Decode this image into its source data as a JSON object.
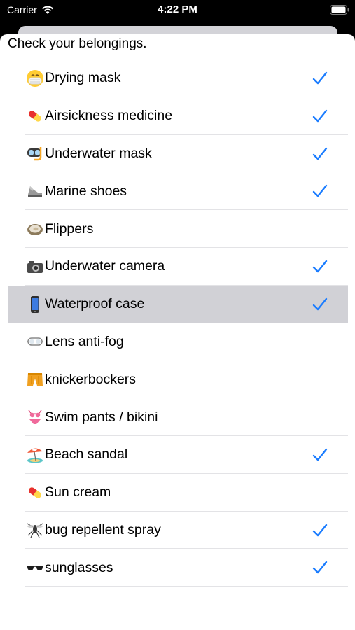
{
  "status_bar": {
    "carrier": "Carrier",
    "time": "4:22 PM"
  },
  "header": {
    "title": "Check your belongings."
  },
  "colors": {
    "accent": "#1a7cff",
    "selected_row": "#d1d1d6",
    "separator": "#e3e3e6"
  },
  "items": [
    {
      "label": "Drying mask",
      "icon": "face-with-medical-mask-icon",
      "checked": true,
      "selected": false
    },
    {
      "label": "Airsickness medicine",
      "icon": "pill-icon",
      "checked": true,
      "selected": false
    },
    {
      "label": "Underwater mask",
      "icon": "diving-mask-icon",
      "checked": true,
      "selected": false
    },
    {
      "label": "Marine shoes",
      "icon": "running-shoe-icon",
      "checked": true,
      "selected": false
    },
    {
      "label": "Flippers",
      "icon": "oyster-icon",
      "checked": false,
      "selected": false
    },
    {
      "label": "Underwater camera",
      "icon": "camera-icon",
      "checked": true,
      "selected": false
    },
    {
      "label": "Waterproof case",
      "icon": "mobile-phone-icon",
      "checked": true,
      "selected": true
    },
    {
      "label": "Lens anti-fog",
      "icon": "goggles-icon",
      "checked": false,
      "selected": false
    },
    {
      "label": "knickerbockers",
      "icon": "shorts-icon",
      "checked": false,
      "selected": false
    },
    {
      "label": "Swim pants / bikini",
      "icon": "bikini-icon",
      "checked": false,
      "selected": false
    },
    {
      "label": "Beach sandal",
      "icon": "beach-umbrella-icon",
      "checked": true,
      "selected": false
    },
    {
      "label": "Sun cream",
      "icon": "pill-icon",
      "checked": false,
      "selected": false
    },
    {
      "label": "bug repellent spray",
      "icon": "mosquito-icon",
      "checked": true,
      "selected": false
    },
    {
      "label": "sunglasses",
      "icon": "sunglasses-icon",
      "checked": true,
      "selected": false
    }
  ]
}
